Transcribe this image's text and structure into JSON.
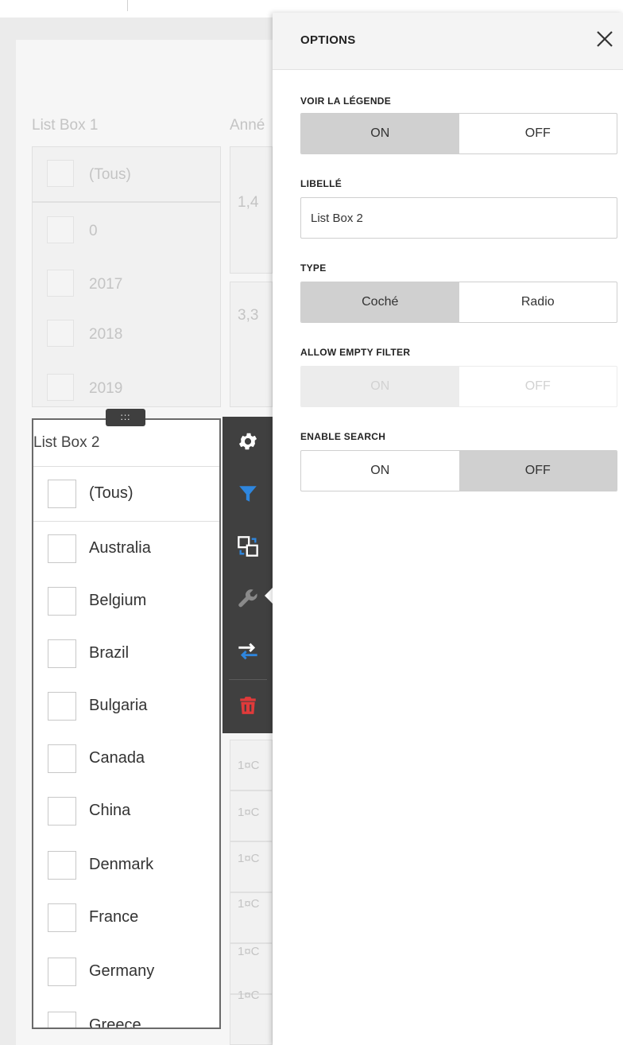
{
  "background_dashboard": {
    "list_box_1": {
      "title": "List Box 1",
      "items": [
        "(Tous)",
        "0",
        "2017",
        "2018",
        "2019"
      ]
    },
    "year_widget": {
      "title_partial": "Anné",
      "values": [
        "1,4",
        "3,3"
      ]
    },
    "table_cells": [
      "1¤C",
      "1¤C",
      "1¤C",
      "1¤C",
      "1¤C",
      "1¤C"
    ]
  },
  "list_box_2": {
    "grip_glyph": ":::",
    "title": "List Box 2",
    "select_all": "(Tous)",
    "items": [
      "Australia",
      "Belgium",
      "Brazil",
      "Bulgaria",
      "Canada",
      "China",
      "Denmark",
      "France",
      "Germany",
      "Greece"
    ]
  },
  "item_toolbar": {
    "buttons": [
      {
        "icon": "gear-icon",
        "color": "#ffffff"
      },
      {
        "icon": "filter-icon",
        "color": "#2e86de"
      },
      {
        "icon": "convert-icon",
        "color": "#ffffff"
      },
      {
        "icon": "wrench-icon",
        "color": "#8a8a8a"
      },
      {
        "icon": "swap-arrows-icon",
        "color": "#2e86de"
      },
      {
        "icon": "trash-icon",
        "color": "#e03a3a"
      }
    ]
  },
  "options_panel": {
    "title": "OPTIONS",
    "close_glyph": "✕",
    "show_legend": {
      "label": "VOIR LA LÉGENDE",
      "on": "ON",
      "off": "OFF",
      "selected": "on"
    },
    "caption": {
      "label": "LIBELLÉ",
      "value": "List Box 2"
    },
    "type": {
      "label": "TYPE",
      "checked": "Coché",
      "radio": "Radio",
      "selected": "checked"
    },
    "allow_empty_filter": {
      "label": "ALLOW EMPTY FILTER",
      "on": "ON",
      "off": "OFF",
      "selected": "on",
      "disabled": true
    },
    "enable_search": {
      "label": "ENABLE SEARCH",
      "on": "ON",
      "off": "OFF",
      "selected": "off"
    }
  },
  "colors": {
    "toolbar_bg": "#404040",
    "segment_selected": "#d0d0d0",
    "accent_blue": "#2e86de",
    "delete_red": "#e03a3a"
  }
}
